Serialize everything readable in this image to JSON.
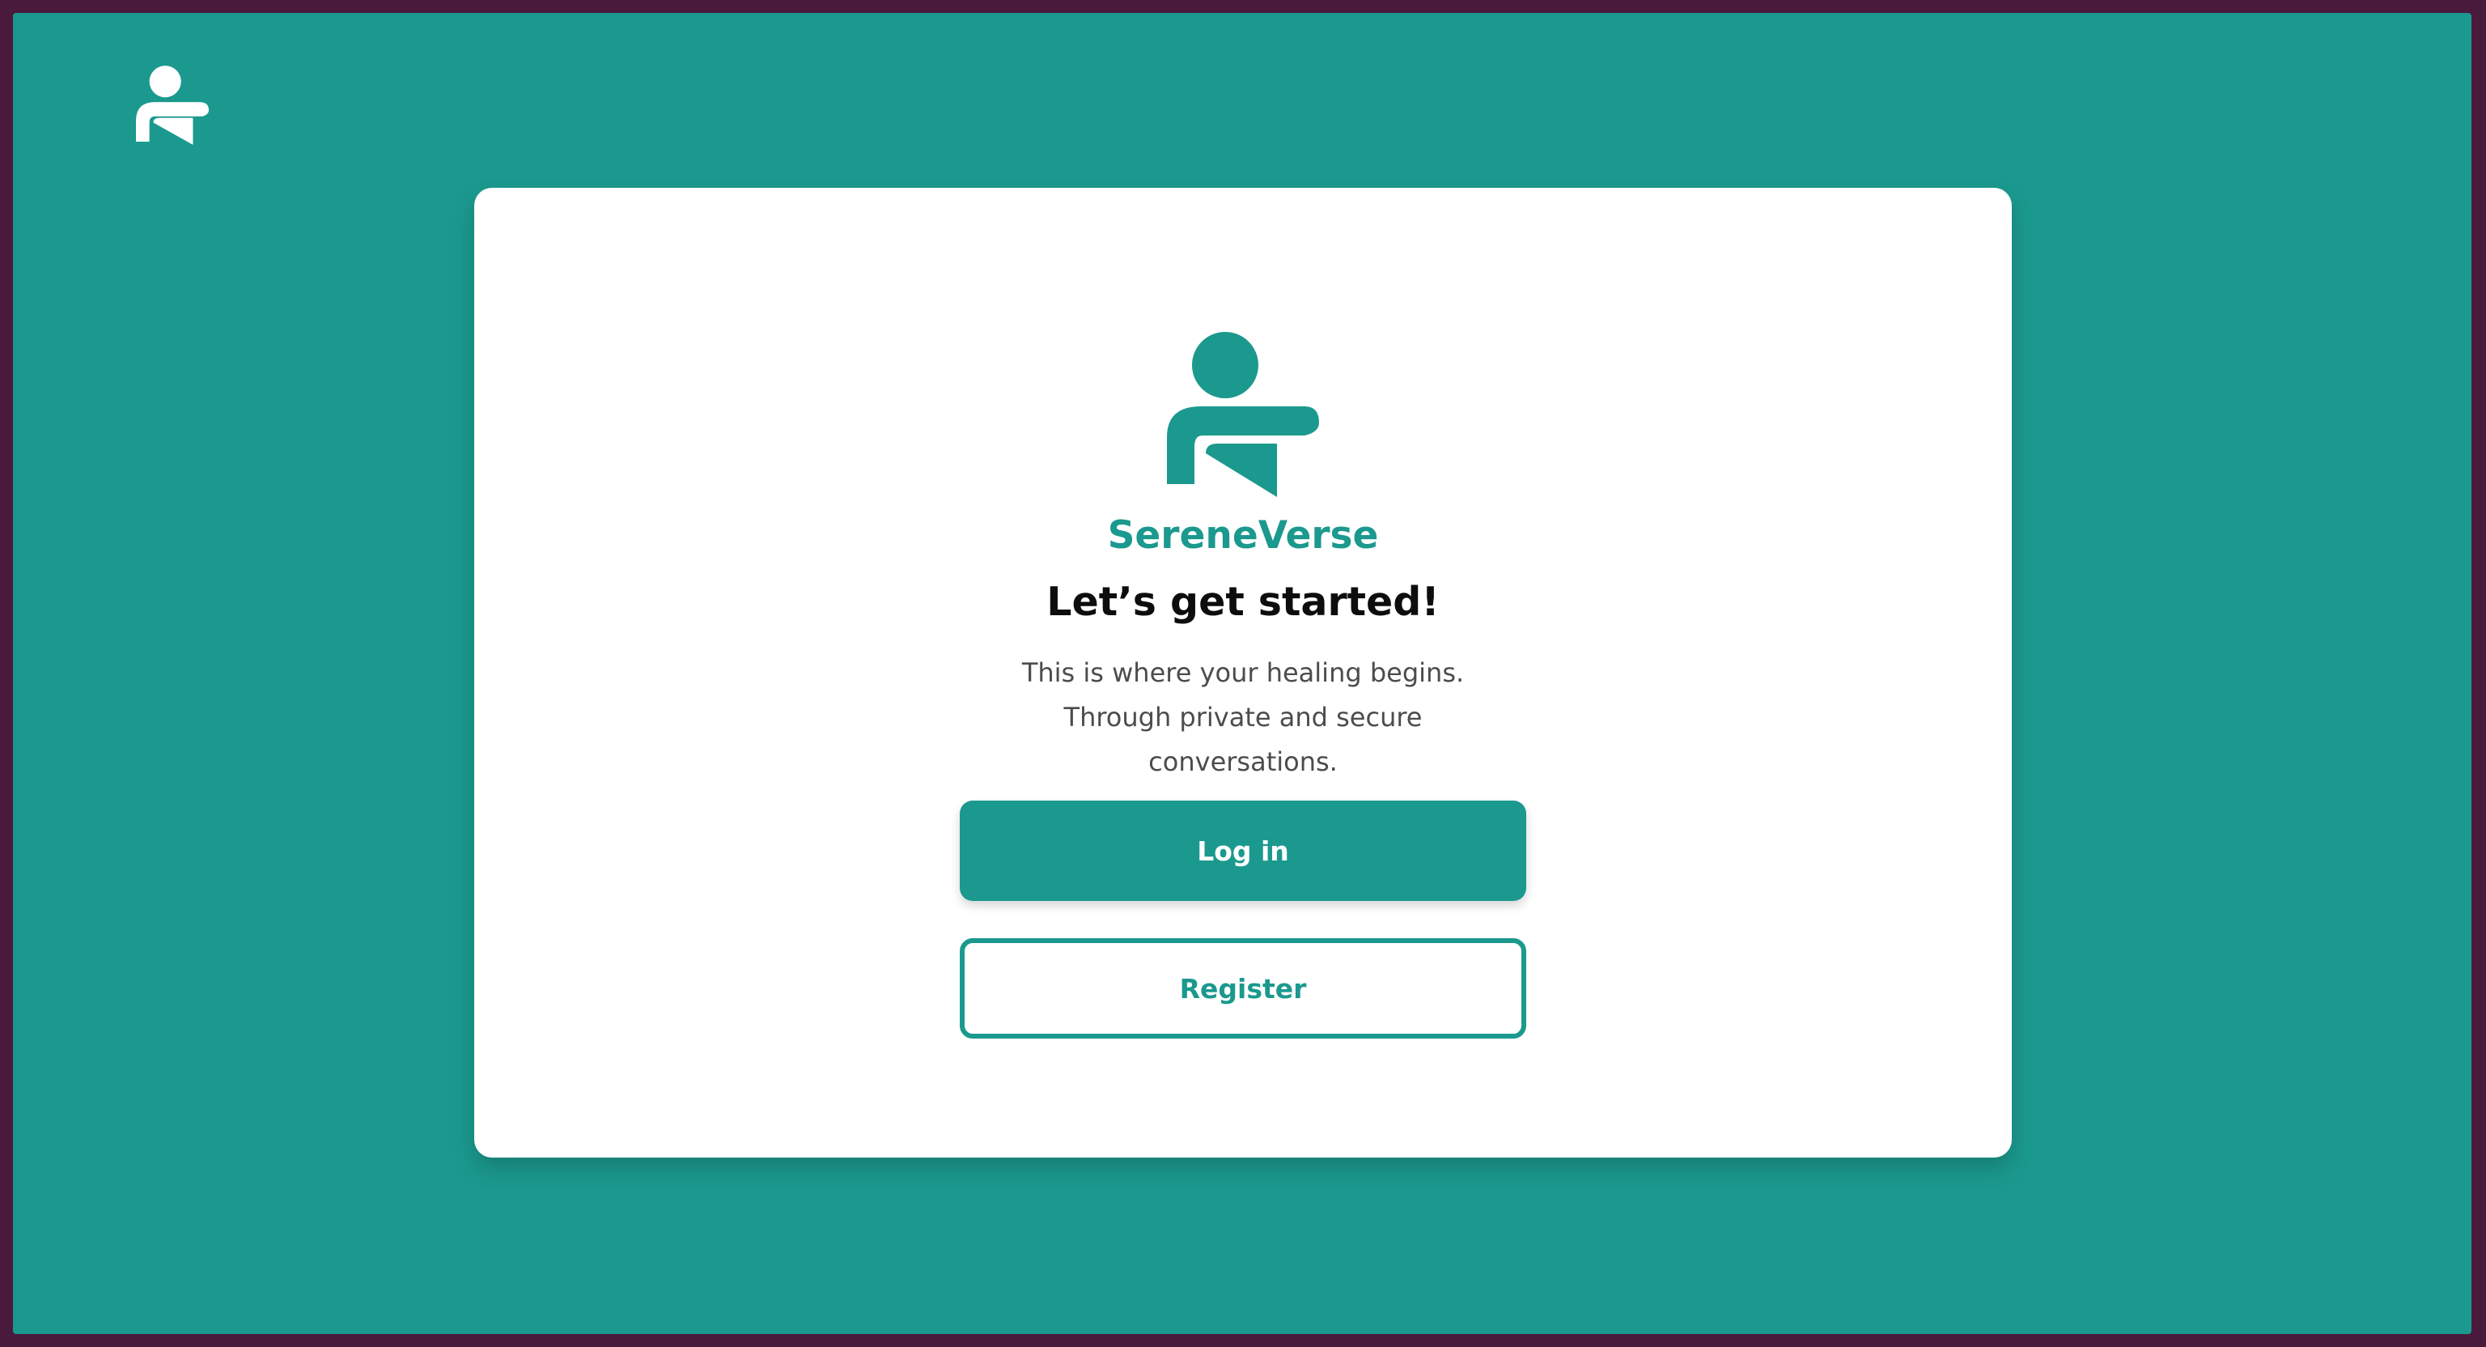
{
  "app": {
    "brand_name": "SereneVerse"
  },
  "colors": {
    "primary": "#1b998e",
    "outer_border": "#4a1a3c",
    "card_bg": "#ffffff",
    "heading": "#0d0d0d",
    "body_text": "#4c4c4c"
  },
  "header": {
    "logo_icon": "person-logo-icon"
  },
  "welcome": {
    "logo_icon": "person-logo-icon",
    "headline": "Let’s get started!",
    "subtitle_lines": [
      "This is where your healing begins.",
      "Through private and secure",
      "conversations."
    ]
  },
  "actions": {
    "login_label": "Log in",
    "register_label": "Register"
  }
}
